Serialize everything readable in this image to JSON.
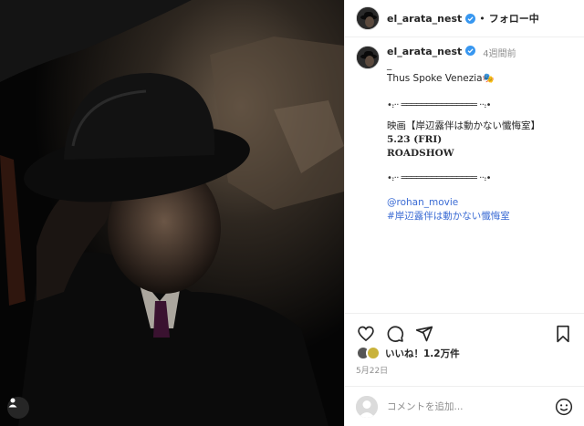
{
  "header": {
    "username": "el_arata_nest",
    "separator": "•",
    "follow_label": "フォロー中"
  },
  "caption": {
    "username": "el_arata_nest",
    "time": "4週間前",
    "lines": {
      "dash": "_",
      "title": "Thus Spoke Venezia🎭",
      "ornament_top": "•⹎·· ═══════════════ ··⹎•",
      "movie": "映画【岸辺露伴は動かない懺悔室】",
      "date": "5.23 (FRI)",
      "roadshow": "ROADSHOW",
      "ornament_bottom": "•⹎·· ═══════════════ ··⹎•",
      "mention": "@rohan_movie",
      "hashtag": "#岸辺露伴は動かない懺悔室"
    }
  },
  "actions": {
    "icons": [
      "heart-icon",
      "comment-icon",
      "share-icon",
      "bookmark-icon"
    ]
  },
  "likes": {
    "text": "いいね！1.2万件"
  },
  "post_date": "5月22日",
  "comment_box": {
    "placeholder": "コメントを追加..."
  },
  "colors": {
    "verified": "#3897f0",
    "link": "#3a6bd4",
    "muted": "#8e8e8e"
  }
}
